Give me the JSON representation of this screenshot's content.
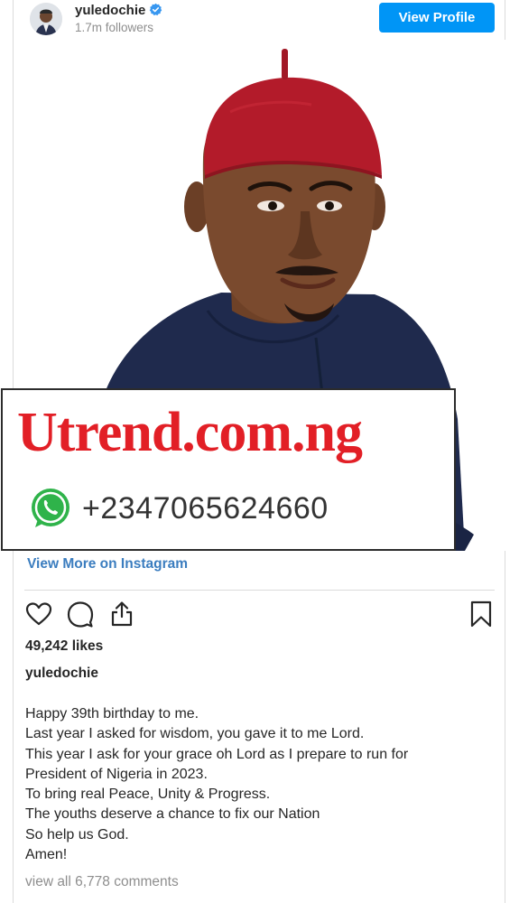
{
  "header": {
    "username": "yuledochie",
    "followers": "1.7m followers",
    "view_profile_label": "View Profile"
  },
  "watermark": {
    "site": "Utrend.com.ng",
    "phone": "+2347065624660"
  },
  "view_more_label": "View More on Instagram",
  "likes": "49,242 likes",
  "caption": {
    "username": "yuledochie",
    "lines": [
      "Happy 39th birthday to me.",
      "Last year I asked for wisdom, you gave it to me Lord.",
      "This year I ask for your grace oh Lord as I prepare to run for",
      "President of Nigeria in 2023.",
      "To bring real Peace, Unity & Progress.",
      "The youths deserve a chance to fix our Nation",
      "So help us God.",
      "Amen!"
    ]
  },
  "comments_label": "view all 6,778 comments",
  "colors": {
    "accent": "#0095f6",
    "link": "#3b7dbf",
    "watermark_red": "#e21f26",
    "cap_red": "#b31b2a",
    "attire_navy": "#1f2a4d"
  },
  "icons": [
    "verified-badge-icon",
    "heart-icon",
    "comment-icon",
    "share-icon",
    "bookmark-icon",
    "whatsapp-icon"
  ]
}
